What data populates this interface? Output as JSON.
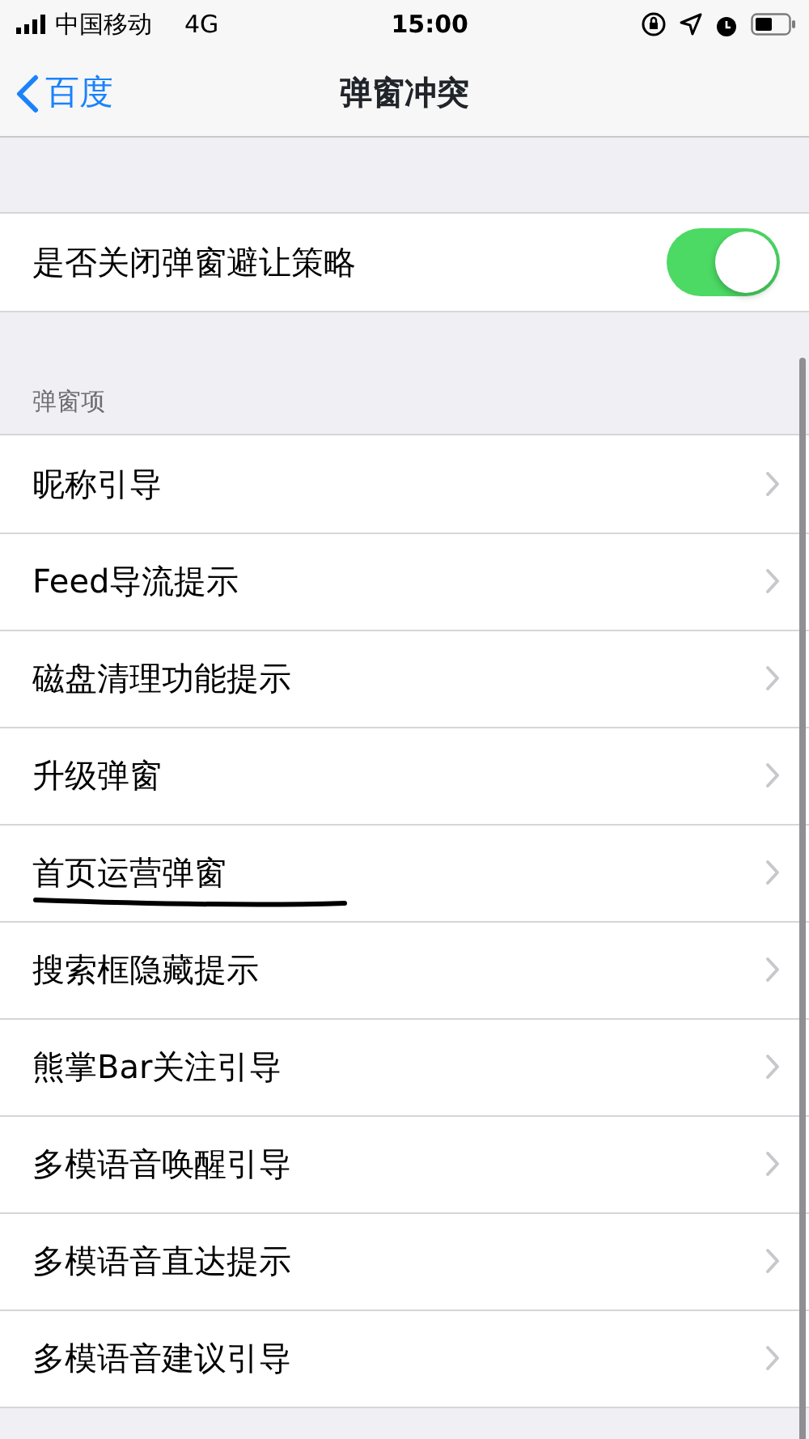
{
  "status_bar": {
    "carrier": "中国移动",
    "network": "4G",
    "time": "15:00"
  },
  "nav": {
    "back": "百度",
    "title": "弹窗冲突"
  },
  "toggle": {
    "label": "是否关闭弹窗避让策略",
    "on": true
  },
  "section": {
    "header": "弹窗项",
    "items": [
      {
        "label": "昵称引导",
        "underlined": false
      },
      {
        "label": "Feed导流提示",
        "underlined": false
      },
      {
        "label": "磁盘清理功能提示",
        "underlined": false
      },
      {
        "label": "升级弹窗",
        "underlined": false
      },
      {
        "label": "首页运营弹窗",
        "underlined": true
      },
      {
        "label": "搜索框隐藏提示",
        "underlined": false
      },
      {
        "label": "熊掌Bar关注引导",
        "underlined": false
      },
      {
        "label": "多模语音唤醒引导",
        "underlined": false
      },
      {
        "label": "多模语音直达提示",
        "underlined": false
      },
      {
        "label": "多模语音建议引导",
        "underlined": false
      }
    ]
  }
}
